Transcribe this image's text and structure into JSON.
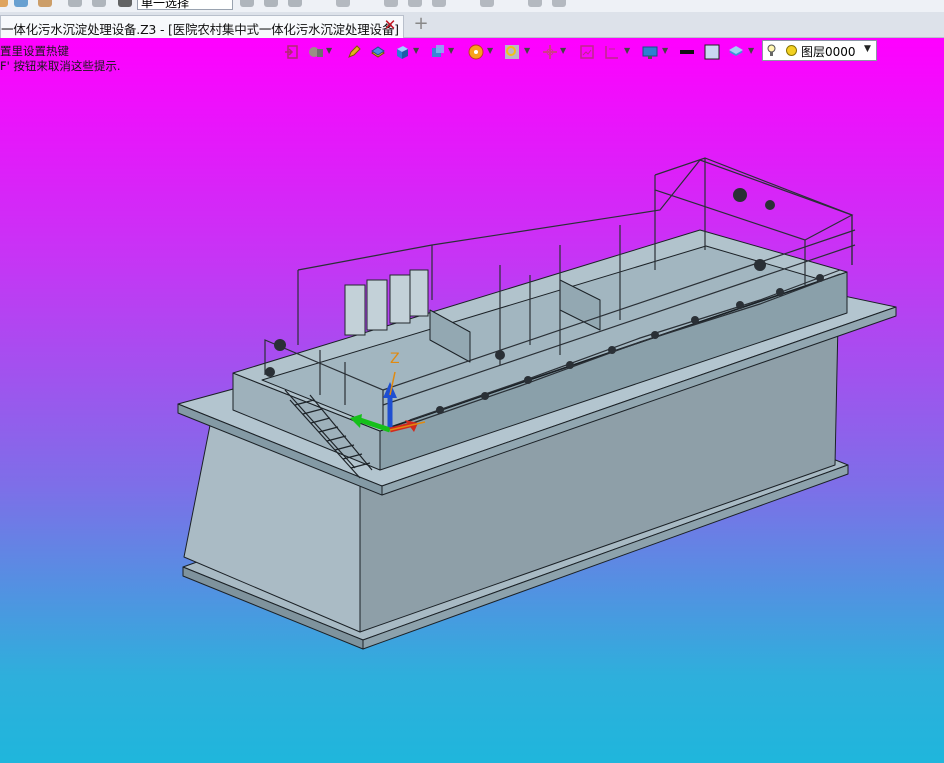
{
  "toolbar": {
    "selection_mode": "单一选择"
  },
  "tab": {
    "title": "一体化污水沉淀处理设备.Z3 - [医院农村集中式一体化污水沉淀处理设备]",
    "close_glyph": "✕",
    "new_tab_glyph": "+"
  },
  "viewport": {
    "hint_line1": "置里设置热键",
    "hint_line2": "F' 按钮来取消这些提示.",
    "background_top": "#ff00ff",
    "background_bottom": "#1fb6dc",
    "model_color": "#a9bcc6",
    "axis": {
      "z_label": "Z",
      "z_color": "#1f4fd1",
      "x_color": "#d12a1f",
      "y_color": "#16c01a"
    }
  },
  "view_toolbar": {
    "icons": [
      "exit-sketch-icon",
      "view-mode-icon",
      "pencil-icon",
      "sheet-icon",
      "cube-icon",
      "view-cube-icon",
      "color-wheel-icon",
      "zoom-icon",
      "move-icon",
      "section-icon",
      "dimension-icon",
      "display-icon",
      "line-color-icon",
      "fill-icon",
      "layer-manager-icon"
    ],
    "layer": {
      "name": "图层0000",
      "color": "#f2d021"
    }
  }
}
